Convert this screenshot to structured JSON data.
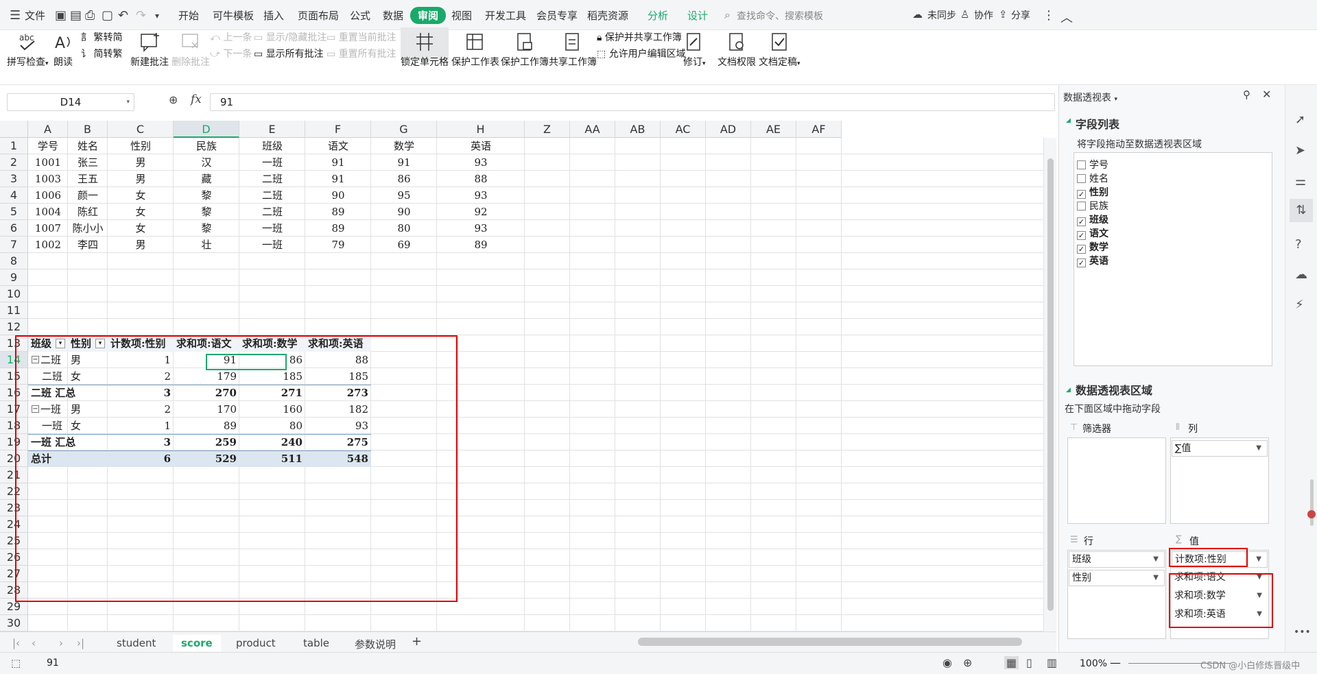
{
  "quick_access": {
    "file_label": "文件"
  },
  "menu": {
    "items": [
      "开始",
      "可牛模板",
      "插入",
      "页面布局",
      "公式",
      "数据",
      "审阅",
      "视图",
      "开发工具",
      "会员专享",
      "稻壳资源"
    ],
    "active": "审阅",
    "context_tabs": [
      "分析",
      "设计"
    ],
    "search_placeholder": "查找命令、搜索模板",
    "sync": "未同步",
    "collab": "协作",
    "share": "分享"
  },
  "ribbon": {
    "spell_check": "拼写检查",
    "read_aloud": "朗读",
    "trad_to_simp": "繁转简",
    "simp_to_trad": "简转繁",
    "new_comment": "新建批注",
    "delete_comment": "删除批注",
    "prev": "上一条",
    "next": "下一条",
    "show_hide_comment": "显示/隐藏批注",
    "show_all_comments": "显示所有批注",
    "reset_current": "重置当前批注",
    "reset_all": "重置所有批注",
    "lock_cell": "锁定单元格",
    "protect_sheet": "保护工作表",
    "protect_book": "保护工作簿",
    "share_book": "共享工作簿",
    "protect_share": "保护并共享工作簿",
    "allow_edit": "允许用户编辑区域",
    "revise": "修订",
    "doc_rights": "文档权限",
    "finalize": "文档定稿"
  },
  "formula_bar": {
    "cell_ref": "D14",
    "fx": "fx",
    "value": "91"
  },
  "columns": [
    "A",
    "B",
    "C",
    "D",
    "E",
    "F",
    "G",
    "H",
    "Z",
    "AA",
    "AB",
    "AC",
    "AD",
    "AE",
    "AF"
  ],
  "rows": [
    "1",
    "2",
    "3",
    "4",
    "5",
    "6",
    "7",
    "8",
    "9",
    "10",
    "11",
    "12",
    "13",
    "14",
    "15",
    "16",
    "17",
    "18",
    "19",
    "20",
    "21",
    "22",
    "23",
    "24",
    "25",
    "26",
    "27",
    "28",
    "29",
    "30"
  ],
  "source_table": {
    "headers": [
      "学号",
      "姓名",
      "性别",
      "民族",
      "班级",
      "语文",
      "数学",
      "英语"
    ],
    "rows": [
      [
        "1001",
        "张三",
        "男",
        "汉",
        "一班",
        "91",
        "91",
        "93"
      ],
      [
        "1003",
        "王五",
        "男",
        "藏",
        "二班",
        "91",
        "86",
        "88"
      ],
      [
        "1006",
        "颜一",
        "女",
        "黎",
        "二班",
        "90",
        "95",
        "93"
      ],
      [
        "1004",
        "陈红",
        "女",
        "黎",
        "二班",
        "89",
        "90",
        "92"
      ],
      [
        "1007",
        "陈小小",
        "女",
        "黎",
        "一班",
        "89",
        "80",
        "93"
      ],
      [
        "1002",
        "李四",
        "男",
        "壮",
        "一班",
        "79",
        "69",
        "89"
      ]
    ]
  },
  "pivot": {
    "headers": [
      "班级",
      "性别",
      "计数项:性别",
      "求和项:语文",
      "求和项:数学",
      "求和项:英语"
    ],
    "rows": [
      {
        "cls": "二班",
        "sex": "男",
        "count": "1",
        "yw": "91",
        "sx": "86",
        "yy": "88"
      },
      {
        "cls": "二班",
        "sex": "女",
        "count": "2",
        "yw": "179",
        "sx": "185",
        "yy": "185"
      },
      {
        "cls": "二班 汇总",
        "sex": "",
        "count": "3",
        "yw": "270",
        "sx": "271",
        "yy": "273"
      },
      {
        "cls": "一班",
        "sex": "男",
        "count": "2",
        "yw": "170",
        "sx": "160",
        "yy": "182"
      },
      {
        "cls": "一班",
        "sex": "女",
        "count": "1",
        "yw": "89",
        "sx": "80",
        "yy": "93"
      },
      {
        "cls": "一班 汇总",
        "sex": "",
        "count": "3",
        "yw": "259",
        "sx": "240",
        "yy": "275"
      },
      {
        "cls": "总计",
        "sex": "",
        "count": "6",
        "yw": "529",
        "sx": "511",
        "yy": "548"
      }
    ]
  },
  "sheet_tabs": [
    "student",
    "score",
    "product",
    "table",
    "参数说明"
  ],
  "active_sheet": "score",
  "status": {
    "value": "91",
    "zoom": "100%",
    "watermark": "CSDN @小白修炼晋级中"
  },
  "panel": {
    "title": "数据透视表",
    "field_list_title": "字段列表",
    "field_list_hint": "将字段拖动至数据透视表区域",
    "fields": [
      {
        "name": "学号",
        "checked": false
      },
      {
        "name": "姓名",
        "checked": false
      },
      {
        "name": "性别",
        "checked": true
      },
      {
        "name": "民族",
        "checked": false
      },
      {
        "name": "班级",
        "checked": true
      },
      {
        "name": "语文",
        "checked": true
      },
      {
        "name": "数学",
        "checked": true
      },
      {
        "name": "英语",
        "checked": true
      }
    ],
    "area_title": "数据透视表区域",
    "area_hint": "在下面区域中拖动字段",
    "filter_label": "筛选器",
    "col_label": "列",
    "col_items": [
      "∑值"
    ],
    "row_label": "行",
    "row_items": [
      "班级",
      "性别"
    ],
    "value_label": "值",
    "value_items": [
      "计数项:性别",
      "求和项:语文",
      "求和项:数学",
      "求和项:英语"
    ]
  },
  "colors": {
    "accent": "#1aa96b",
    "highlight_red": "#e00000",
    "pivot_total_bg": "#dce6f0"
  }
}
